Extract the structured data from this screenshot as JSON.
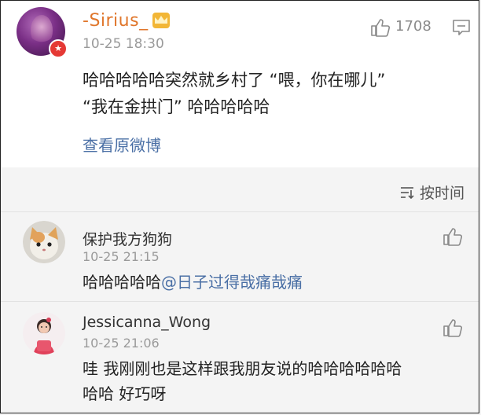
{
  "post": {
    "username": "-Sirius_",
    "crown_icon": "crown-icon",
    "timestamp": "10-25 18:30",
    "like_count": "1708",
    "text_line1": "哈哈哈哈哈突然就乡村了 “喂，你在哪儿”",
    "text_line2": "“我在金拱门” 哈哈哈哈哈",
    "view_original": "查看原微博"
  },
  "sort": {
    "label": "按时间",
    "icon": "sort-icon"
  },
  "comments": [
    {
      "username": "保护我方狗狗",
      "timestamp": "10-25 21:15",
      "text": "哈哈哈哈哈",
      "mention": "@日子过得哉痛哉痛"
    },
    {
      "username": "Jessicanna_Wong",
      "timestamp": "10-25 21:06",
      "text_line1": "哇 我刚刚也是这样跟我朋友说的哈哈哈哈哈哈",
      "text_line2": "哈哈 好巧呀"
    }
  ],
  "colors": {
    "username": "#e0762b",
    "link": "#4a6fa5",
    "timestamp": "#9a9a9a"
  }
}
